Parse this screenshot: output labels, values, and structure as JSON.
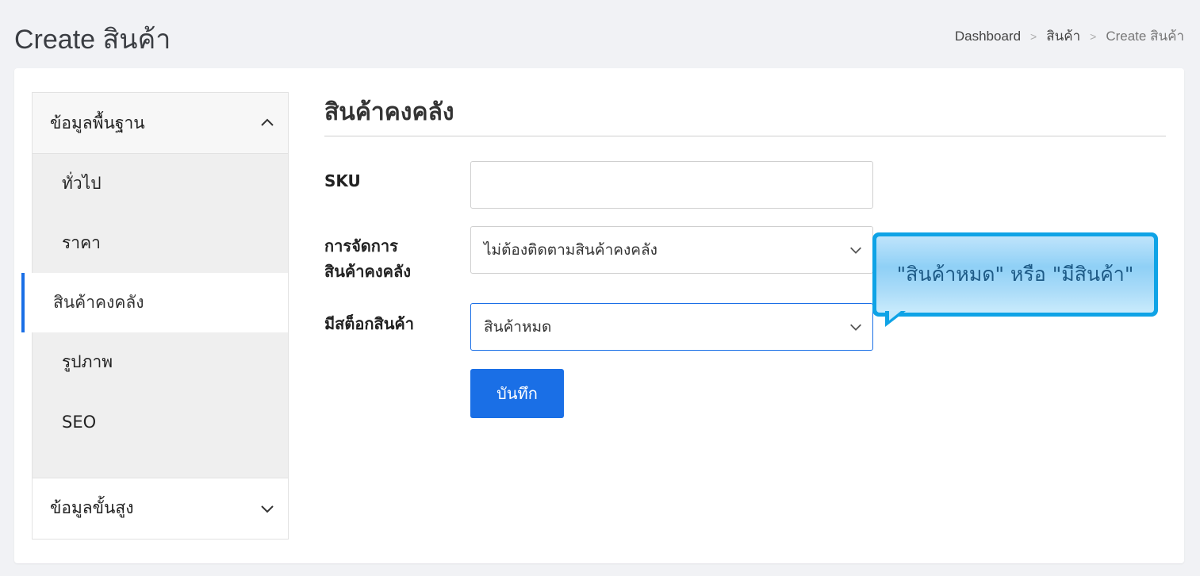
{
  "header": {
    "title": "Create สินค้า",
    "breadcrumb": [
      {
        "label": "Dashboard"
      },
      {
        "label": "สินค้า"
      },
      {
        "label": "Create สินค้า"
      }
    ],
    "breadcrumb_separator": ">"
  },
  "sidebar": {
    "basic_section": "ข้อมูลพื้นฐาน",
    "items": [
      {
        "label": "ทั่วไป"
      },
      {
        "label": "ราคา"
      },
      {
        "label": "สินค้าคงคลัง",
        "active": true
      },
      {
        "label": "รูปภาพ"
      },
      {
        "label": "SEO"
      }
    ],
    "advanced_section": "ข้อมูลขั้นสูง"
  },
  "main": {
    "section_title": "สินค้าคงคลัง",
    "fields": {
      "sku_label": "SKU",
      "sku_value": "",
      "inventory_label_line1": "การจัดการ",
      "inventory_label_line2": "สินค้าคงคลัง",
      "inventory_value": "ไม่ต้องติดตามสินค้าคงคลัง",
      "stock_label": "มีสต็อกสินค้า",
      "stock_value": "สินค้าหมด"
    },
    "save_label": "บันทึก"
  },
  "callout": {
    "text": "\"สินค้าหมด\" หรือ \"มีสินค้า\""
  },
  "colors": {
    "primary": "#1a6fe6",
    "callout_border": "#0fa3e6",
    "callout_text": "#1d5a86"
  }
}
